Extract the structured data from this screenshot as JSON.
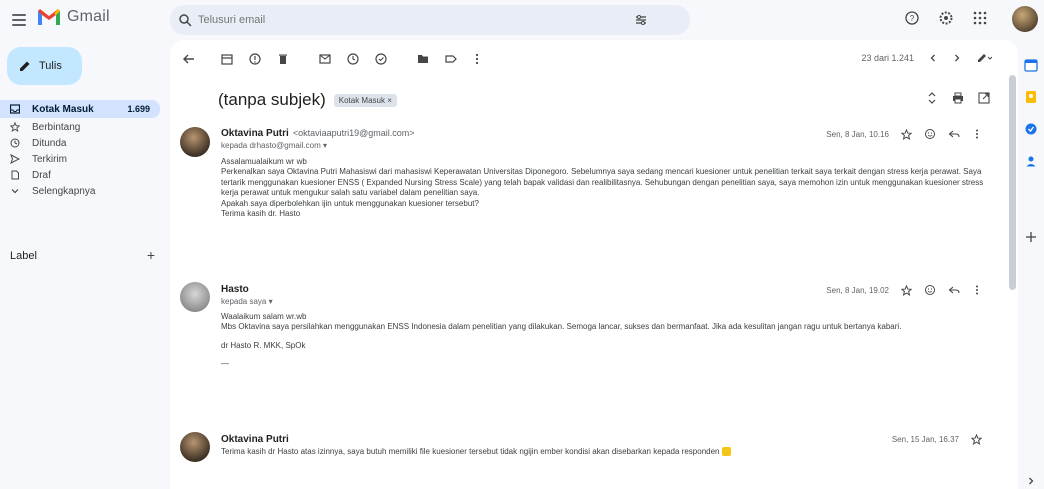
{
  "app": {
    "name": "Gmail"
  },
  "search": {
    "placeholder": "Telusuri email"
  },
  "sidebar": {
    "compose_label": "Tulis",
    "items": [
      {
        "label": "Kotak Masuk",
        "count": "1.699",
        "icon": "inbox-icon",
        "active": true
      },
      {
        "label": "Berbintang",
        "count": "",
        "icon": "star-icon"
      },
      {
        "label": "Ditunda",
        "count": "",
        "icon": "clock-icon"
      },
      {
        "label": "Terkirim",
        "count": "",
        "icon": "send-icon"
      },
      {
        "label": "Draf",
        "count": "",
        "icon": "draft-icon"
      },
      {
        "label": "Selengkapnya",
        "count": "",
        "icon": "chevron-down-icon"
      }
    ],
    "labels_heading": "Label",
    "labels_add": "+"
  },
  "toolbar": {
    "pagination": "23 dari 1.241"
  },
  "thread": {
    "subject": "(tanpa subjek)",
    "label_chip": "Kotak Masuk ×",
    "messages": [
      {
        "sender": "Oktavina Putri",
        "email": "<oktaviaaputri19@gmail.com>",
        "to": "kepada drhasto@gmail.com ▾",
        "date": "Sen, 8 Jan, 10.16",
        "body": [
          "Assalamualaikum wr wb",
          "Perkenalkan saya Oktavina Putri Mahasiswi dari mahasiswi Keperawatan Universitas Diponegoro. Sebelumnya saya sedang mencari kuesioner untuk penelitian terkait saya terkait dengan stress kerja perawat. Saya tertarik menggunakan kuesioner ENSS ( Expanded Nursing Stress Scale) yang telah bapak validasi dan realibilitasnya. Sehubungan dengan penelitian saya, saya memohon izin untuk menggunakan kuesioner stress kerja perawat untuk mengukur salah satu variabel dalam penelitian saya.",
          "Apakah saya diperbolehkan ijin untuk menggunakan kuesioner tersebut?",
          "Terima kasih dr. Hasto"
        ]
      },
      {
        "sender": "Hasto",
        "email": "",
        "to": "kepada saya ▾",
        "date": "Sen, 8 Jan, 19.02",
        "body": [
          "Waalaikum salam wr.wb",
          "Mbs Oktavina saya persilahkan menggunakan ENSS Indonesia dalam penelitian yang dilakukan. Semoga lancar, sukses dan bermanfaat. Jika ada kesulitan jangan ragu untuk bertanya kabari.",
          "",
          "dr Hasto R. MKK, SpOk",
          "—"
        ]
      },
      {
        "sender": "Oktavina Putri",
        "email": "",
        "to": "",
        "date": "Sen, 15 Jan, 16.37",
        "body": [
          "Terima kasih dr Hasto atas izinnya, saya butuh memiliki file kuesioner tersebut tidak ngijin ember kondisi akan disebarkan kepada responden"
        ]
      }
    ]
  },
  "colors": {
    "accent": "#0b57d0",
    "compose_bg": "#c2e7ff",
    "active_bg": "#d3e3fd",
    "background": "#f6f8fc"
  }
}
